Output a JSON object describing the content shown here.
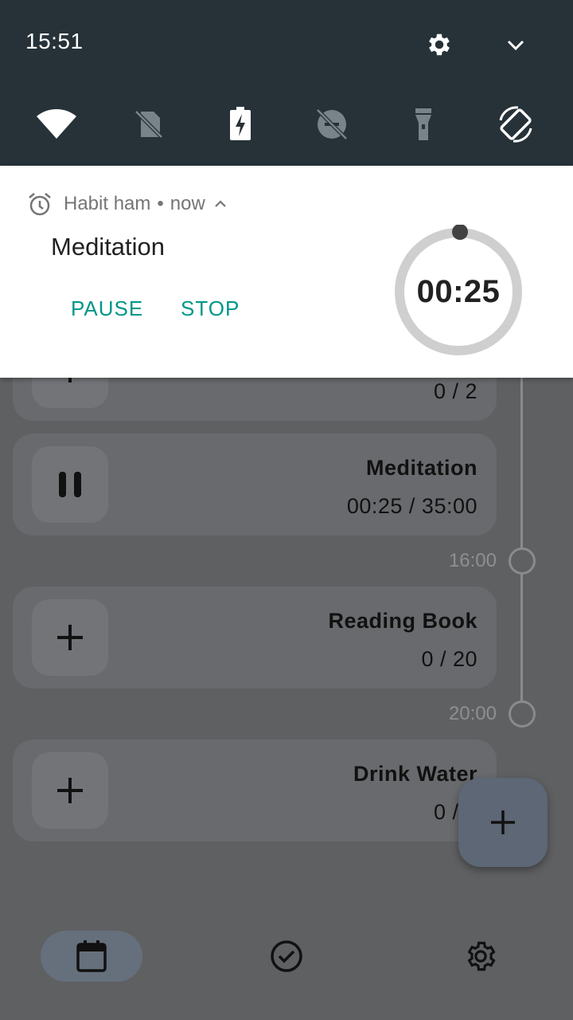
{
  "status_bar": {
    "time": "15:51"
  },
  "quick_settings": {
    "top_icons": [
      "gear-icon",
      "chevron-down-icon"
    ],
    "tiles": [
      "wifi-icon",
      "no-sim-icon",
      "battery-charging-icon",
      "data-saver-off-icon",
      "flashlight-icon",
      "auto-rotate-icon"
    ]
  },
  "notification": {
    "app_name": "Habit ham",
    "separator": "•",
    "time": "now",
    "title": "Meditation",
    "actions": {
      "pause": "PAUSE",
      "stop": "STOP"
    },
    "timer": "00:25",
    "accent_color": "#009688"
  },
  "habits": [
    {
      "title": "",
      "progress": "0 / 2",
      "button_icon": "plus-icon"
    },
    {
      "title": "Meditation",
      "progress": "00:25 / 35:00",
      "button_icon": "pause-icon"
    },
    {
      "title": "Reading Book",
      "progress": "0 / 20",
      "button_icon": "plus-icon"
    },
    {
      "title": "Drink Water",
      "progress": "0 / 2",
      "button_icon": "plus-icon"
    }
  ],
  "timeline": {
    "labels": [
      "16:00",
      "20:00"
    ]
  },
  "fab": {
    "icon": "plus-icon"
  },
  "bottom_nav": {
    "items": [
      {
        "icon": "calendar-icon",
        "active": true
      },
      {
        "icon": "check-circle-icon",
        "active": false
      },
      {
        "icon": "gear-icon",
        "active": false
      }
    ]
  }
}
